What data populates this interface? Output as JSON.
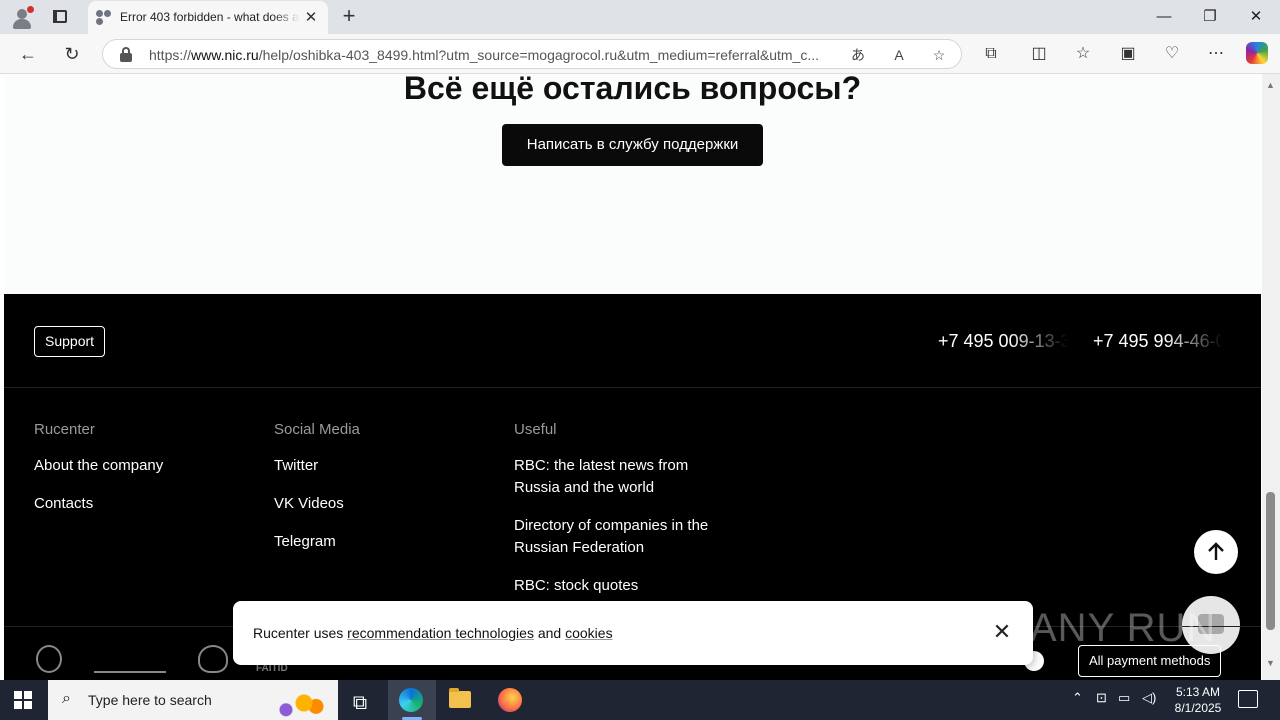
{
  "browser": {
    "tab_title": "Error 403 forbidden - what does a",
    "url_prefix": "https://",
    "url_domain": "www.nic.ru",
    "url_rest": "/help/oshibka-403_8499.html?utm_source=mogagrocol.ru&utm_medium=referral&utm_c..."
  },
  "page": {
    "question_title": "Всё ещё остались вопросы?",
    "cta_label": "Написать в службу поддержки"
  },
  "footer": {
    "support_label": "Support",
    "phone_1": "+7 495 009-13-3",
    "phone_2": "+7 495 994-46-0",
    "columns": [
      {
        "heading": "Rucenter",
        "links": [
          "About the company",
          "Contacts"
        ]
      },
      {
        "heading": "Social Media",
        "links": [
          "Twitter",
          "VK Videos",
          "Telegram"
        ]
      },
      {
        "heading": "Useful",
        "links": [
          "RBC: the latest news from Russia and the world",
          "Directory of companies in the Russian Federation",
          "RBC: stock quotes"
        ]
      }
    ],
    "payment_label": "All payment methods",
    "logo_text": "FAITID"
  },
  "cookie": {
    "text_1": "Rucenter uses ",
    "link_1": "recommendation technologies",
    "text_2": " and ",
    "link_2": "cookies"
  },
  "watermark": "ANY RUN",
  "taskbar": {
    "search_placeholder": "Type here to search",
    "time": "5:13 AM",
    "date": "8/1/2025"
  }
}
